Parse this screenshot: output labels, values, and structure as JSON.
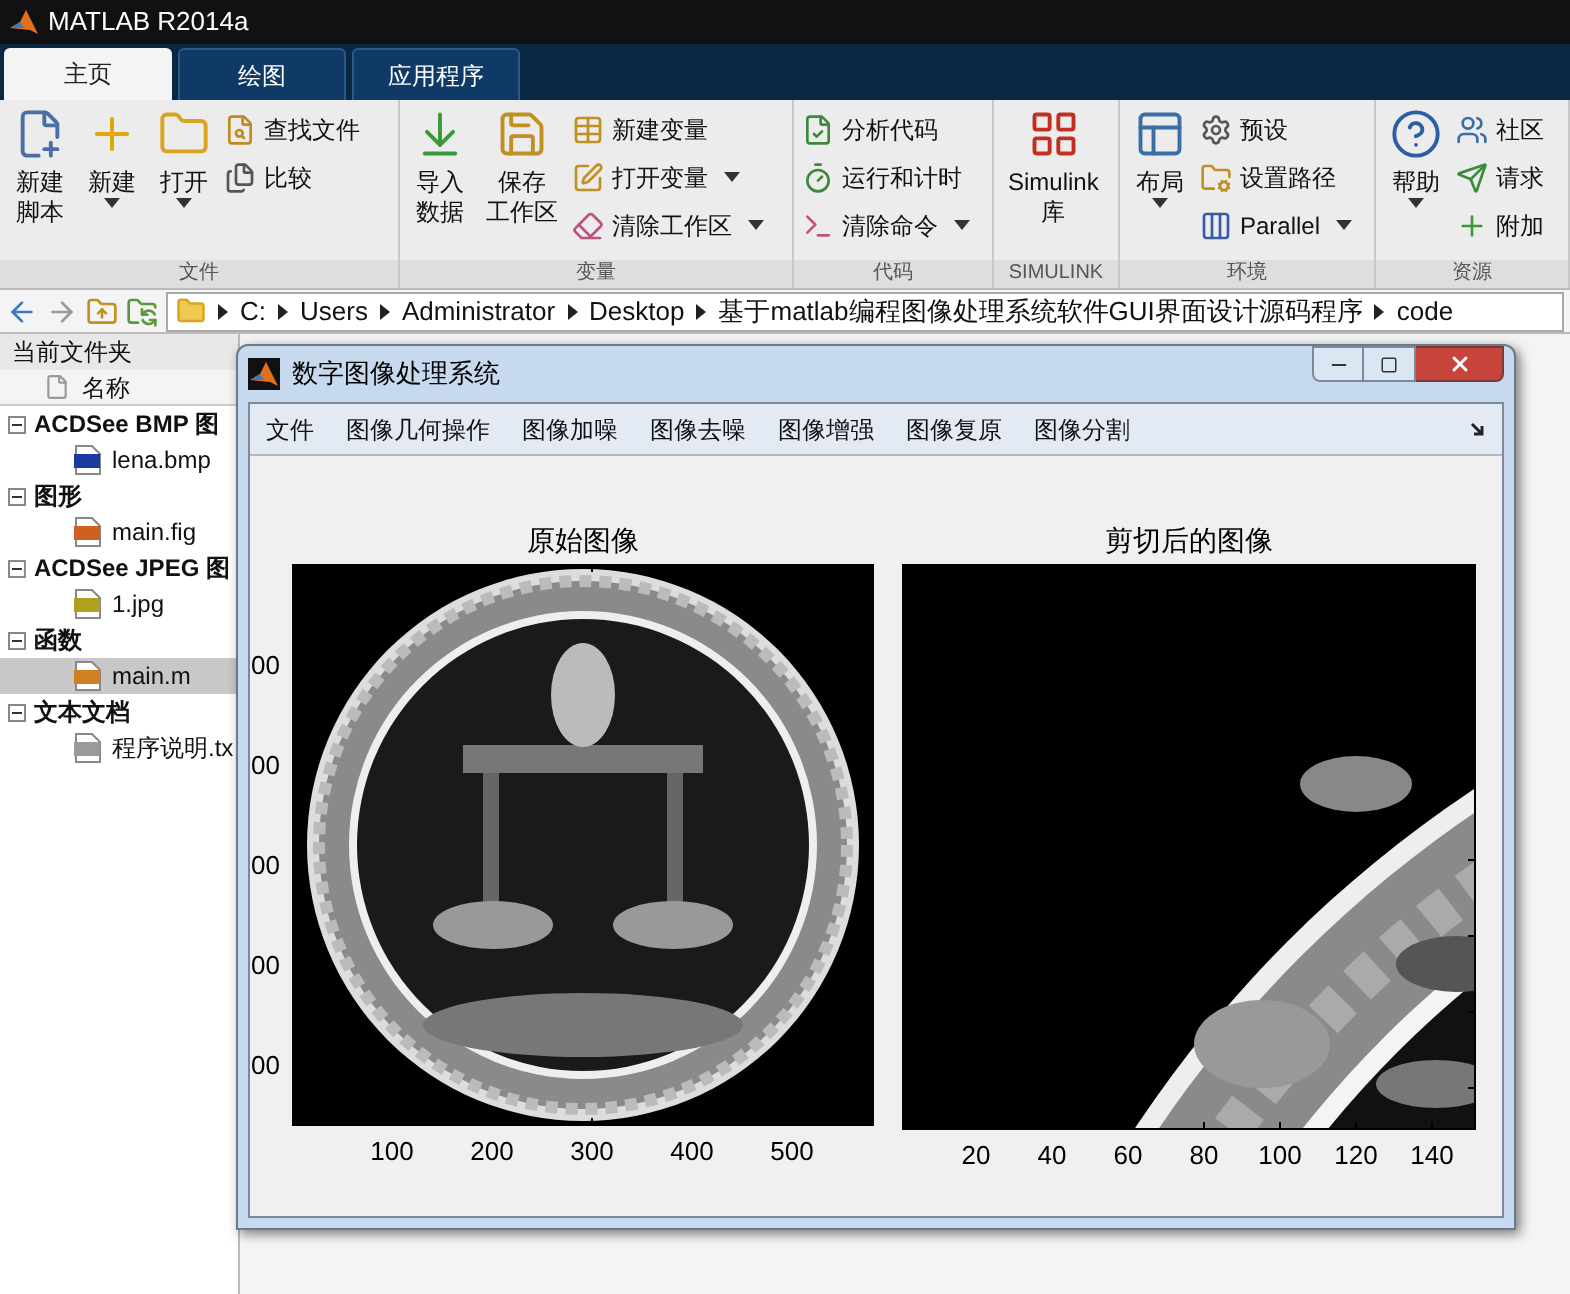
{
  "app": {
    "title": "MATLAB R2014a"
  },
  "tabs": [
    {
      "label": "主页",
      "selected": true
    },
    {
      "label": "绘图",
      "selected": false
    },
    {
      "label": "应用程序",
      "selected": false
    }
  ],
  "ribbon": [
    {
      "label": "文件",
      "large": [
        {
          "lines": [
            "新建",
            "脚本"
          ],
          "menu": false
        },
        {
          "lines": [
            "新建"
          ],
          "menu": true
        },
        {
          "lines": [
            "打开"
          ],
          "menu": true
        }
      ],
      "small": [
        {
          "label": "查找文件",
          "menu": false
        },
        {
          "label": "比较",
          "menu": false
        }
      ]
    },
    {
      "label": "变量",
      "large": [
        {
          "lines": [
            "导入",
            "数据"
          ],
          "menu": false
        },
        {
          "lines": [
            "保存",
            "工作区"
          ],
          "menu": false
        }
      ],
      "small": [
        {
          "label": "新建变量",
          "menu": false
        },
        {
          "label": "打开变量",
          "menu": true
        },
        {
          "label": "清除工作区",
          "menu": true
        }
      ]
    },
    {
      "label": "代码",
      "small": [
        {
          "label": "分析代码",
          "menu": false
        },
        {
          "label": "运行和计时",
          "menu": false
        },
        {
          "label": "清除命令",
          "menu": true
        }
      ]
    },
    {
      "label": "SIMULINK",
      "large": [
        {
          "lines": [
            "Simulink",
            "库"
          ],
          "menu": false
        }
      ]
    },
    {
      "label": "环境",
      "large": [
        {
          "lines": [
            "布局"
          ],
          "menu": true
        }
      ],
      "small": [
        {
          "label": "预设",
          "menu": false
        },
        {
          "label": "设置路径",
          "menu": false
        },
        {
          "label": "Parallel",
          "menu": true
        }
      ]
    },
    {
      "label": "资源",
      "large": [
        {
          "lines": [
            "帮助"
          ],
          "menu": true
        }
      ],
      "small": [
        {
          "label": "社区",
          "menu": false
        },
        {
          "label": "请求",
          "menu": false
        },
        {
          "label": "附加",
          "menu": false
        }
      ]
    }
  ],
  "address": {
    "segments": [
      "C:",
      "Users",
      "Administrator",
      "Desktop",
      "基于matlab编程图像处理系统软件GUI界面设计源码程序",
      "code"
    ]
  },
  "file_panel": {
    "title": "当前文件夹",
    "column": "名称",
    "groups": [
      {
        "label": "ACDSee BMP 图",
        "expanded": true,
        "children": [
          {
            "name": "lena.bmp",
            "kind": "bmp",
            "selected": false
          }
        ]
      },
      {
        "label": "图形",
        "expanded": true,
        "children": [
          {
            "name": "main.fig",
            "kind": "fig",
            "selected": false
          }
        ]
      },
      {
        "label": "ACDSee JPEG 图",
        "expanded": true,
        "children": [
          {
            "name": "1.jpg",
            "kind": "jpg",
            "selected": false
          }
        ]
      },
      {
        "label": "函数",
        "expanded": true,
        "children": [
          {
            "name": "main.m",
            "kind": "m",
            "selected": true
          }
        ]
      },
      {
        "label": "文本文档",
        "expanded": true,
        "children": [
          {
            "name": "程序说明.tx",
            "kind": "txt",
            "selected": false
          }
        ]
      }
    ]
  },
  "figure": {
    "title": "数字图像处理系统",
    "menu": [
      "文件",
      "图像几何操作",
      "图像加噪",
      "图像去噪",
      "图像增强",
      "图像复原",
      "图像分割"
    ],
    "axes": [
      {
        "title": "原始图像",
        "kind": "full",
        "xticks": [
          "100",
          "200",
          "300",
          "400",
          "500"
        ],
        "yticks": [
          "00",
          "00",
          "00",
          "00",
          "00"
        ]
      },
      {
        "title": "剪切后的图像",
        "kind": "crop",
        "xticks": [
          "20",
          "40",
          "60",
          "80",
          "100",
          "120",
          "140"
        ]
      }
    ]
  }
}
